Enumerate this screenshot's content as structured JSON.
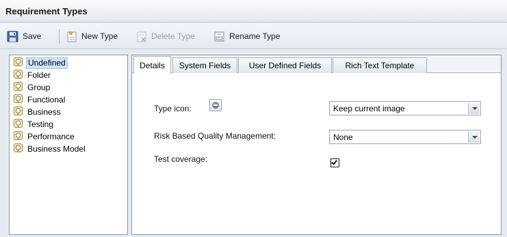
{
  "window": {
    "title": "Requirement Types"
  },
  "toolbar": {
    "save_label": "Save",
    "new_type_label": "New Type",
    "delete_type_label": "Delete Type",
    "rename_type_label": "Rename Type",
    "icons": {
      "save": "floppy-disk-icon",
      "new_type": "new-document-icon",
      "delete_type": "delete-document-icon",
      "rename_type": "rename-icon"
    }
  },
  "types_list": {
    "selected": "Undefined",
    "items": [
      "Undefined",
      "Folder",
      "Group",
      "Functional",
      "Business",
      "Testing",
      "Performance",
      "Business Model"
    ]
  },
  "tabs": [
    "Details",
    "System Fields",
    "User Defined Fields",
    "Rich Text Template"
  ],
  "active_tab": "Details",
  "details": {
    "type_icon_label": "Type icon:",
    "type_icon_select_value": "Keep current image",
    "risk_label": "Risk Based Quality Management:",
    "risk_value": "None",
    "test_coverage_label": "Test coverage:",
    "test_coverage_checked": true
  },
  "colors": {
    "selection": "#cfe3fb",
    "panel_border": "#8d99a8",
    "background": "#e6ebf2"
  }
}
